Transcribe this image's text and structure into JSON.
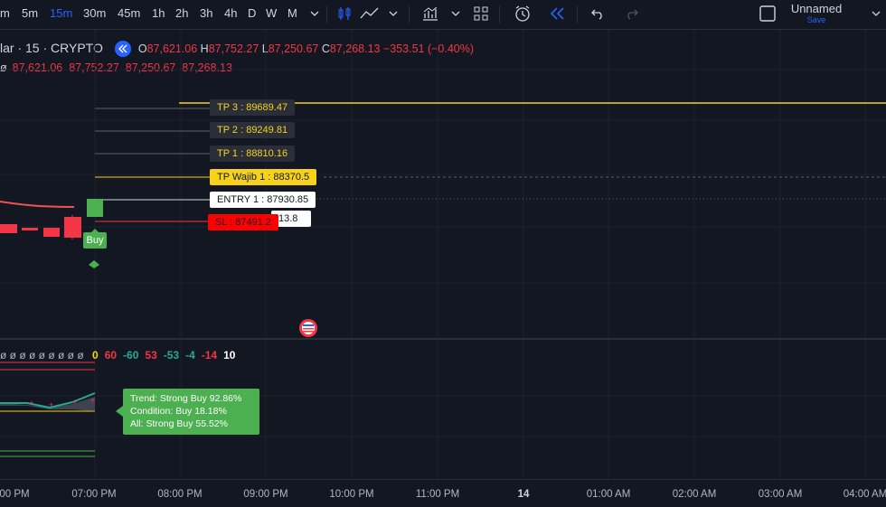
{
  "toolbar": {
    "intervals": [
      {
        "label": "m",
        "active": false
      },
      {
        "label": "5m",
        "active": false
      },
      {
        "label": "15m",
        "active": true
      },
      {
        "label": "30m",
        "active": false
      },
      {
        "label": "45m",
        "active": false
      },
      {
        "label": "1h",
        "active": false
      },
      {
        "label": "2h",
        "active": false
      },
      {
        "label": "3h",
        "active": false
      },
      {
        "label": "4h",
        "active": false
      },
      {
        "label": "D",
        "active": false
      },
      {
        "label": "W",
        "active": false
      },
      {
        "label": "M",
        "active": false
      }
    ],
    "layout_name": "Unnamed",
    "save_label": "Save"
  },
  "legend": {
    "symbol": "lar · 15 · CRYPTO",
    "o_label": "O",
    "o_value": "87,621.06",
    "h_label": "H",
    "h_value": "87,752.27",
    "l_label": "L",
    "l_value": "87,250.67",
    "c_label": "C",
    "c_value": "87,268.13",
    "change": "−353.51 (−0.40%)",
    "study_prefix": "ø",
    "study_values": "87,621.06  87,752.27  87,250.67  87,268.13"
  },
  "trade_labels": {
    "tp3": "TP 3 : 89689.47",
    "tp2": "TP 2 : 89249.81",
    "tp1": "TP 1 : 88810.16",
    "tp_wajib": "TP Wajib 1 : 88370.5",
    "entry": "ENTRY 1 : 87930.85",
    "hidden_partial": "13.8",
    "sl": "SL : 87491.2",
    "buy": "Buy"
  },
  "oscillator": {
    "dummy_zeros": "ø ø ø ø ø ø ø ø ø",
    "values": [
      {
        "text": "0",
        "color": "#f7d21a"
      },
      {
        "text": "60",
        "color": "#f23645"
      },
      {
        "text": "-60",
        "color": "#22ab94"
      },
      {
        "text": "53",
        "color": "#f23645"
      },
      {
        "text": "-53",
        "color": "#22ab94"
      },
      {
        "text": "-4",
        "color": "#22ab94"
      },
      {
        "text": "-14",
        "color": "#f23645"
      },
      {
        "text": "10",
        "color": "#ffffff"
      }
    ],
    "tooltip_lines": [
      "Trend: Strong Buy 92.86%",
      "Condition: Buy 18.18%",
      "All: Strong Buy 55.52%"
    ]
  },
  "xaxis": {
    "ticks": [
      "00 PM",
      "07:00 PM",
      "08:00 PM",
      "09:00 PM",
      "10:00 PM",
      "11:00 PM",
      "14",
      "01:00 AM",
      "02:00 AM",
      "03:00 AM",
      "04:00 AM"
    ]
  },
  "colors": {
    "background": "#131722",
    "accent": "#2962ff",
    "bull": "#4caf50",
    "bear": "#f23645",
    "tp_line": "#f7d21a"
  }
}
